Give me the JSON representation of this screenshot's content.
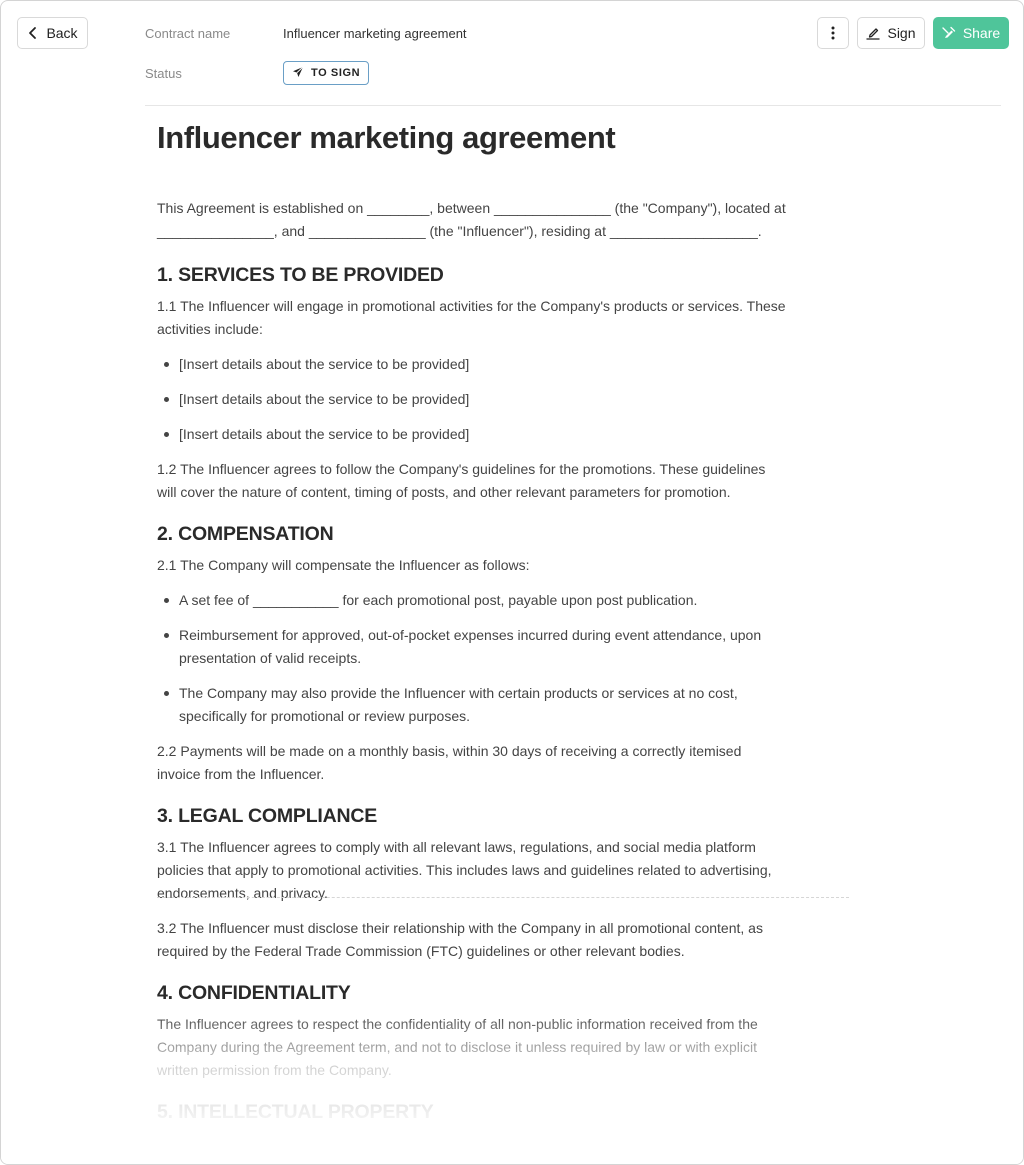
{
  "header": {
    "back_label": "Back",
    "contract_name_label": "Contract name",
    "contract_name_value": "Influencer marketing agreement",
    "status_label": "Status",
    "status_value": "TO SIGN",
    "sign_label": "Sign",
    "share_label": "Share"
  },
  "icons": {
    "back": "chevron-left-icon",
    "more": "more-vertical-icon",
    "sign": "signature-pen-icon",
    "share": "share-icon",
    "status": "paper-plane-icon"
  },
  "colors": {
    "share_button": "#4fc59a",
    "status_border": "#6a9fc6"
  },
  "document": {
    "title": "Influencer marketing agreement",
    "intro": "This Agreement is established on ________, between _______________ (the \"Company\"), located at _______________, and _______________ (the \"Influencer\"), residing at ___________________.",
    "sections": [
      {
        "heading": "1. SERVICES TO BE PROVIDED",
        "p1": "1.1 The Influencer will engage in promotional activities for the Company's products or services. These activities include:",
        "bullets": [
          "[Insert details about the service to be provided]",
          "[Insert details about the service to be provided]",
          "[Insert details about the service to be provided]"
        ],
        "p2": "1.2 The Influencer agrees to follow the Company's guidelines for the promotions. These guidelines will cover the nature of content, timing of posts, and other relevant parameters for promotion."
      },
      {
        "heading": "2. COMPENSATION",
        "p1": "2.1 The Company will compensate the Influencer as follows:",
        "bullets": [
          "A set fee of ___________ for each promotional post, payable upon post publication.",
          "Reimbursement for approved, out-of-pocket expenses incurred during event attendance, upon presentation of valid receipts.",
          "The Company may also provide the Influencer with certain products or services at no cost, specifically for promotional or review purposes."
        ],
        "p2": "2.2 Payments will be made on a monthly basis, within 30 days of receiving a correctly itemised invoice from the Influencer."
      },
      {
        "heading": "3. LEGAL COMPLIANCE",
        "p1": "3.1 The Influencer agrees to comply with all relevant laws, regulations, and social media platform policies that apply to promotional activities. This includes laws and guidelines related to advertising, endorsements, and privacy.",
        "p2": "3.2 The Influencer must disclose their relationship with the Company in all promotional content, as required by the Federal Trade Commission (FTC) guidelines or other relevant bodies."
      },
      {
        "heading": "4. CONFIDENTIALITY",
        "p1": "The Influencer agrees to respect the confidentiality of all non-public information received from the Company during the Agreement term, and not to disclose it unless required by law or with explicit written permission from the Company."
      },
      {
        "heading": "5. INTELLECTUAL PROPERTY"
      }
    ]
  }
}
